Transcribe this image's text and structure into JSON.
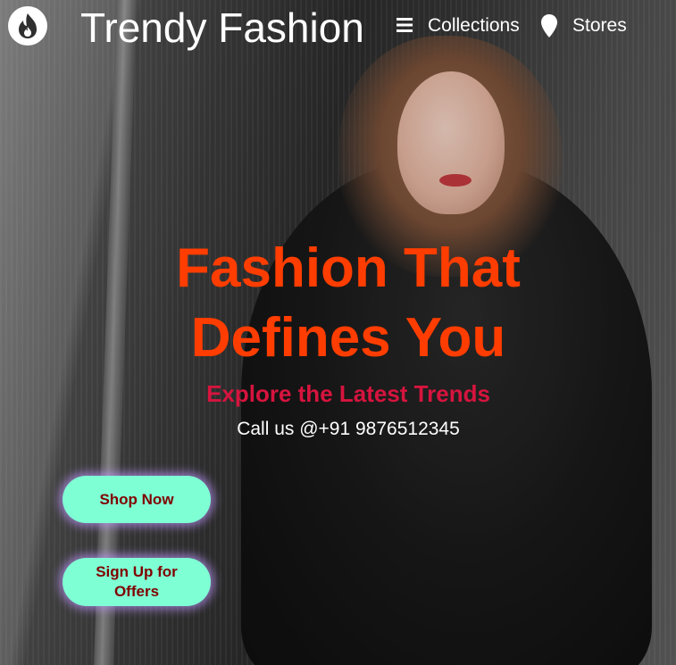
{
  "header": {
    "brand": "Trendy Fashion",
    "logo_icon": "flame-icon",
    "menu_icon": "hamburger-menu-icon",
    "nav": {
      "collections": "Collections",
      "stores_icon": "location-pin-icon",
      "stores": "Stores"
    }
  },
  "hero": {
    "title": "Fashion That Defines You",
    "subtitle": "Explore the Latest Trends",
    "call": "Call us @+91 9876512345"
  },
  "buttons": {
    "shop_now": "Shop Now",
    "sign_up": "Sign Up for Offers"
  },
  "colors": {
    "title": "#ff3d00",
    "subtitle": "#d6143e",
    "button_bg": "#7fffd4",
    "button_text": "#800000",
    "button_glow": "#be96ff"
  }
}
